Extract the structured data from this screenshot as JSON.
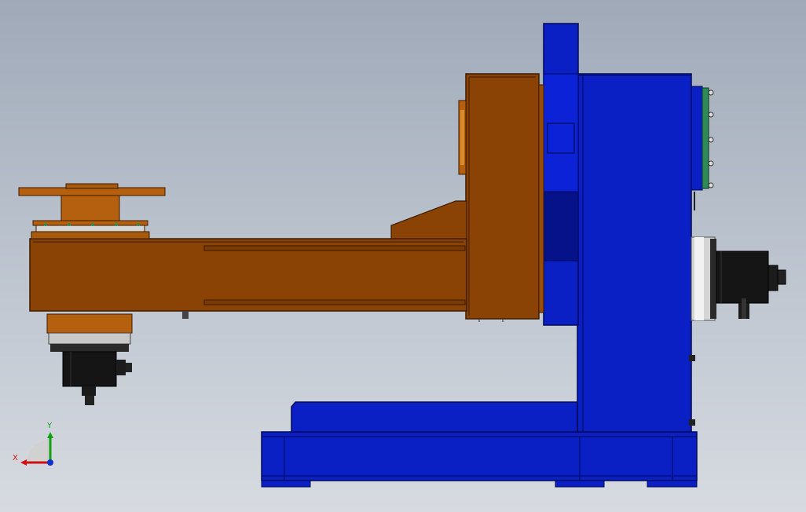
{
  "colors": {
    "background_top": "#9fa9b8",
    "background_bottom": "#d7dbe1",
    "frame_blue": "#0a1fc4",
    "frame_blue_dark": "#06138a",
    "arm_orange": "#8a4205",
    "arm_orange_light": "#b4600f",
    "motor_black": "#111111",
    "flange_green": "#2e8b57",
    "ring_gray": "#c9c9c9",
    "axis_x": "#d01010",
    "axis_y": "#10a010",
    "axis_z": "#1030d0"
  },
  "triad": {
    "x_label": "X",
    "y_label": "Y"
  }
}
